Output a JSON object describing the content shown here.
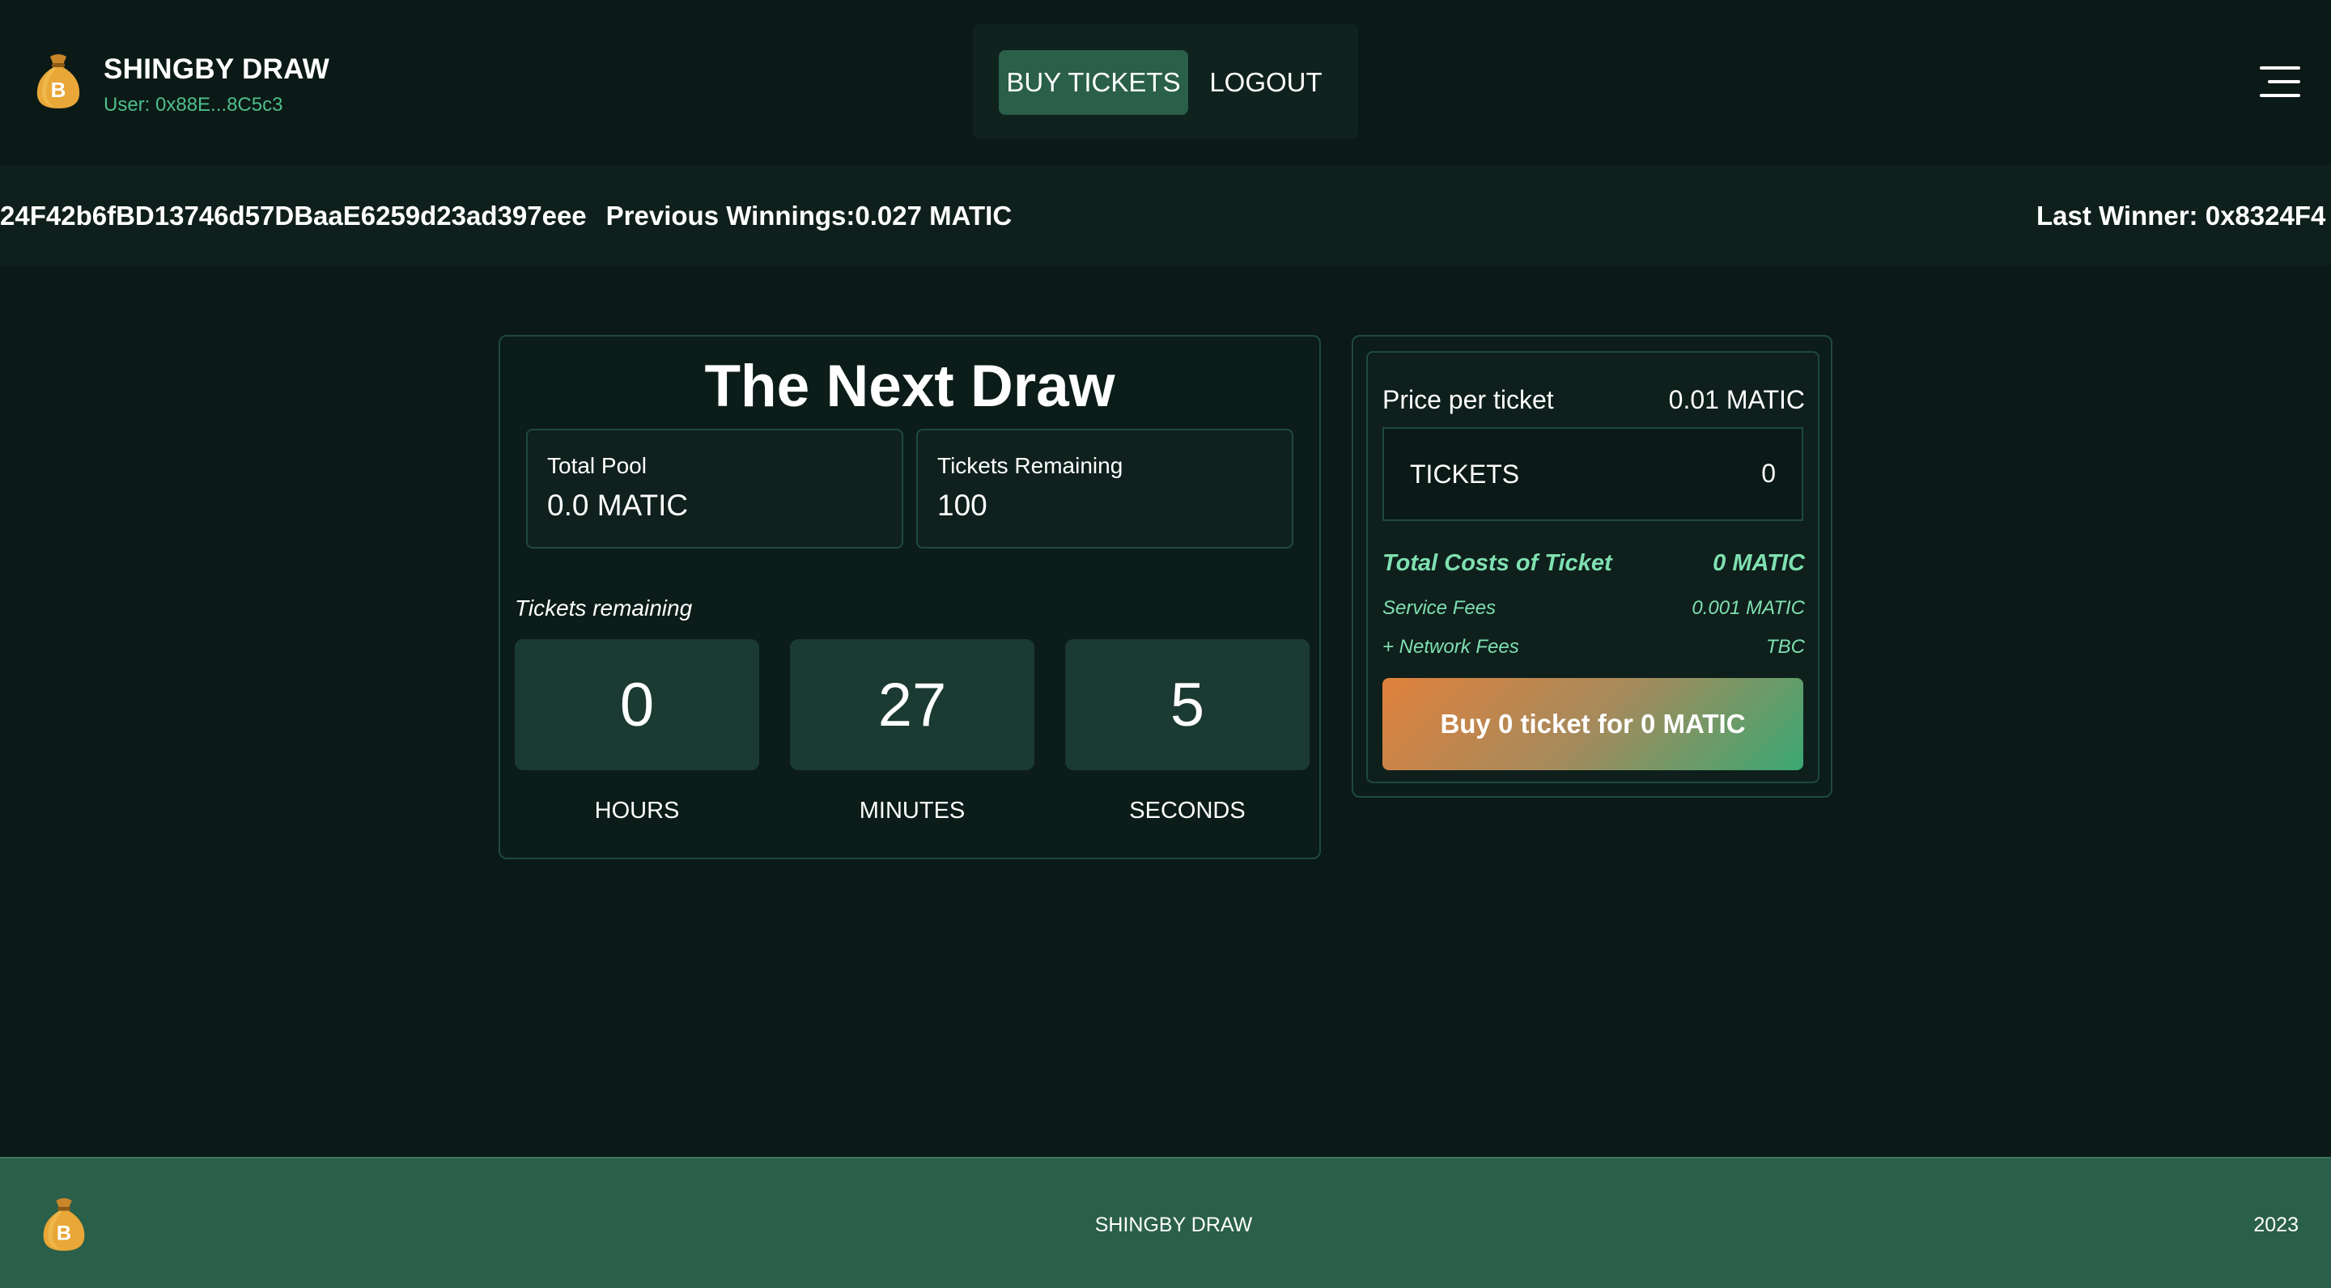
{
  "brand": {
    "title": "SHINGBY DRAW",
    "user": "User: 0x88E...8C5c3",
    "logo_icon": "money-bag-icon"
  },
  "nav": {
    "buy_label": "BUY TICKETS",
    "logout_label": "LOGOUT",
    "menu_icon": "hamburger-menu-icon"
  },
  "ticker": {
    "address_fragment": "24F42b6fBD13746d57DBaaE6259d23ad397eee",
    "previous_winnings": "Previous Winnings:0.027 MATIC",
    "last_winner": "Last Winner: 0x8324F4"
  },
  "draw": {
    "title": "The Next Draw",
    "total_pool_label": "Total Pool",
    "total_pool_value": "0.0 MATIC",
    "tickets_remaining_label": "Tickets Remaining",
    "tickets_remaining_value": "100",
    "countdown_label": "Tickets remaining",
    "hours_value": "0",
    "hours_label": "HOURS",
    "minutes_value": "27",
    "minutes_label": "MINUTES",
    "seconds_value": "5",
    "seconds_label": "SECONDS"
  },
  "purchase": {
    "price_label": "Price per ticket",
    "price_value": "0.01 MATIC",
    "tickets_label": "TICKETS",
    "tickets_value": "0",
    "total_label": "Total Costs of Ticket",
    "total_value": "0 MATIC",
    "service_fee_label": "Service Fees",
    "service_fee_value": "0.001 MATIC",
    "network_fee_label": "+ Network Fees",
    "network_fee_value": "TBC",
    "buy_button_label": "Buy 0 ticket for 0 MATIC"
  },
  "footer": {
    "title": "SHINGBY DRAW",
    "year": "2023"
  },
  "colors": {
    "background": "#0b1a17",
    "accent": "#2a5f4a",
    "highlight_text": "#7fe0b0",
    "gradient_start": "#e0813c",
    "gradient_end": "#3aa873"
  }
}
